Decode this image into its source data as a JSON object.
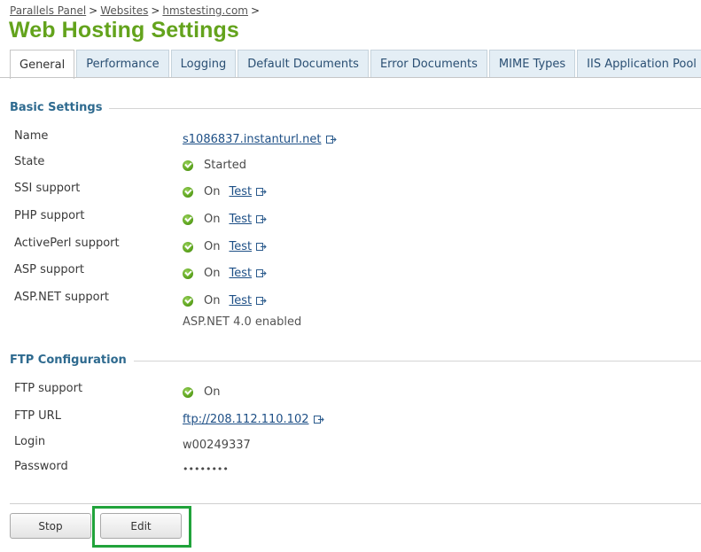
{
  "breadcrumb": {
    "items": [
      "Parallels Panel",
      "Websites",
      "hmstesting.com"
    ],
    "separator": ">"
  },
  "page_title": "Web Hosting Settings",
  "tabs": [
    {
      "label": "General",
      "active": true
    },
    {
      "label": "Performance",
      "active": false
    },
    {
      "label": "Logging",
      "active": false
    },
    {
      "label": "Default Documents",
      "active": false
    },
    {
      "label": "Error Documents",
      "active": false
    },
    {
      "label": "MIME Types",
      "active": false
    },
    {
      "label": "IIS Application Pool",
      "active": false
    }
  ],
  "basic_settings": {
    "title": "Basic Settings",
    "name_label": "Name",
    "name_value": "s1086837.instanturl.net",
    "state_label": "State",
    "state_value": "Started",
    "ssi_label": "SSI support",
    "ssi_value": "On",
    "php_label": "PHP support",
    "php_value": "On",
    "perl_label": "ActivePerl support",
    "perl_value": "On",
    "asp_label": "ASP support",
    "asp_value": "On",
    "aspnet_label": "ASP.NET support",
    "aspnet_value": "On",
    "aspnet_note": "ASP.NET 4.0 enabled",
    "test_label": "Test"
  },
  "ftp": {
    "title": "FTP Configuration",
    "support_label": "FTP support",
    "support_value": "On",
    "url_label": "FTP URL",
    "url_value": "ftp://208.112.110.102",
    "login_label": "Login",
    "login_value": "w00249337",
    "password_label": "Password",
    "password_value": "••••••••"
  },
  "buttons": {
    "stop": "Stop",
    "edit": "Edit"
  },
  "colors": {
    "title_green": "#63a31c",
    "section_blue": "#2e6a8f",
    "link_blue": "#1d4f86",
    "highlight_green": "#21a33b"
  },
  "icons": {
    "status": "green-check-icon",
    "external": "external-link-icon"
  }
}
